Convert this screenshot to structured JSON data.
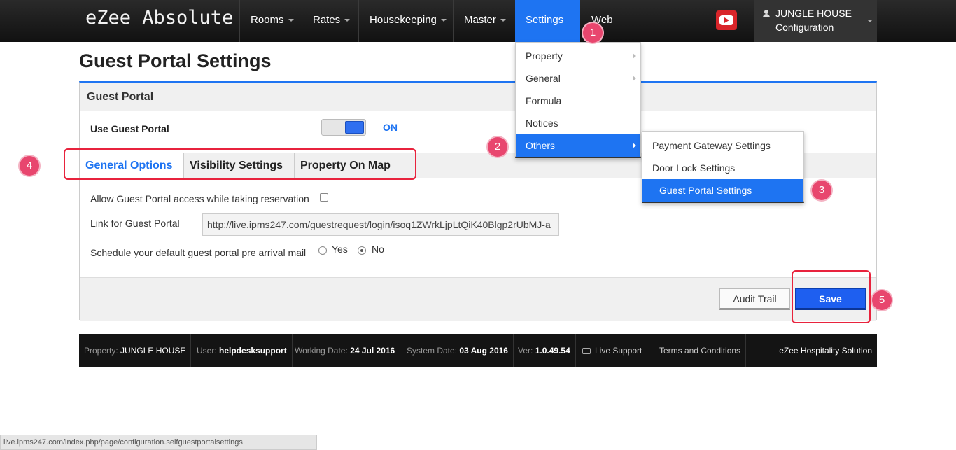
{
  "brand": "eZee Absolute",
  "nav": {
    "rooms": "Rooms",
    "rates": "Rates",
    "housekeeping": "Housekeeping",
    "master": "Master",
    "settings": "Settings",
    "web": "Web"
  },
  "user": {
    "name": "JUNGLE HOUSE",
    "role": "Configuration"
  },
  "page_title": "Guest Portal Settings",
  "panel": {
    "heading": "Guest Portal",
    "use_label": "Use Guest Portal",
    "toggle_state": "ON"
  },
  "tabs": [
    "General Options",
    "Visibility Settings",
    "Property On Map"
  ],
  "options": {
    "allow_access_label": "Allow Guest Portal access while taking reservation",
    "link_label": "Link for Guest Portal",
    "link_value": "http://live.ipms247.com/guestrequest/login/isoq1ZWrkLjpLtQiK40Blgp2rUbMJ-a",
    "schedule_label": "Schedule your default guest portal pre arrival mail",
    "radio_yes": "Yes",
    "radio_no": "No",
    "selected": "No"
  },
  "buttons": {
    "audit": "Audit Trail",
    "save": "Save"
  },
  "settings_menu": [
    "Property",
    "General",
    "Formula",
    "Notices",
    "Others"
  ],
  "others_menu": [
    "Payment Gateway Settings",
    "Door Lock Settings",
    "Guest Portal Settings"
  ],
  "footer": {
    "property_label": "Property:",
    "property_value": "JUNGLE HOUSE",
    "user_label": "User:",
    "user_value": "helpdesksupport",
    "working_label": "Working Date:",
    "working_value": "24 Jul 2016",
    "system_label": "System Date:",
    "system_value": "03 Aug 2016",
    "ver_label": "Ver:",
    "ver_value": "1.0.49.54",
    "live_support": "Live Support",
    "terms": "Terms and Conditions",
    "company": "eZee Hospitality Solution"
  },
  "annotations": [
    "1",
    "2",
    "3",
    "4",
    "5"
  ],
  "status_url": "live.ipms247.com/index.php/page/configuration.selfguestportalsettings",
  "colors": {
    "accent": "#1e74f2",
    "annotation": "#e8466e",
    "highlight": "#e8233d"
  }
}
